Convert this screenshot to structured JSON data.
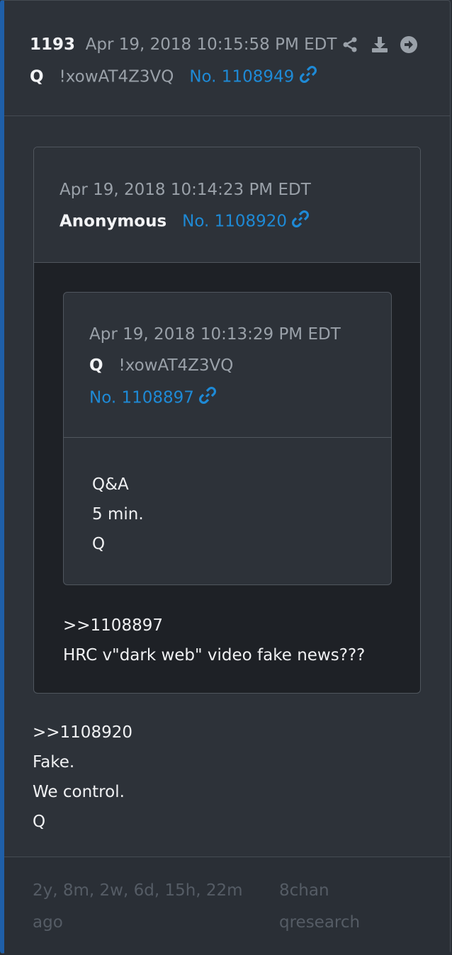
{
  "post": {
    "number": "1193",
    "timestamp": "Apr 19, 2018 10:15:58 PM EDT",
    "author": "Q",
    "tripcode": "!xowAT4Z3VQ",
    "post_no": "No. 1108949",
    "icons": [
      "share-icon",
      "download-icon",
      "arrow-right-circle-icon",
      "link-icon"
    ]
  },
  "quote": {
    "timestamp": "Apr 19, 2018 10:14:23 PM EDT",
    "author": "Anonymous",
    "post_no": "No. 1108920",
    "nested": {
      "timestamp": "Apr 19, 2018 10:13:29 PM EDT",
      "author": "Q",
      "tripcode": "!xowAT4Z3VQ",
      "post_no": "No. 1108897",
      "lines": [
        "Q&A",
        "5 min.",
        "Q"
      ]
    },
    "lines": [
      ">>1108897",
      "HRC v\"dark web\" video fake news???"
    ]
  },
  "body": {
    "lines": [
      ">>1108920",
      "Fake.",
      "We control.",
      "Q"
    ]
  },
  "footer": {
    "ago_line1": "2y, 8m, 2w, 6d, 15h, 22m",
    "ago_line2": "ago",
    "source_line1": "8chan",
    "source_line2": "qresearch"
  },
  "colors": {
    "accent": "#1f5fa8",
    "link": "#1e8ad6"
  }
}
